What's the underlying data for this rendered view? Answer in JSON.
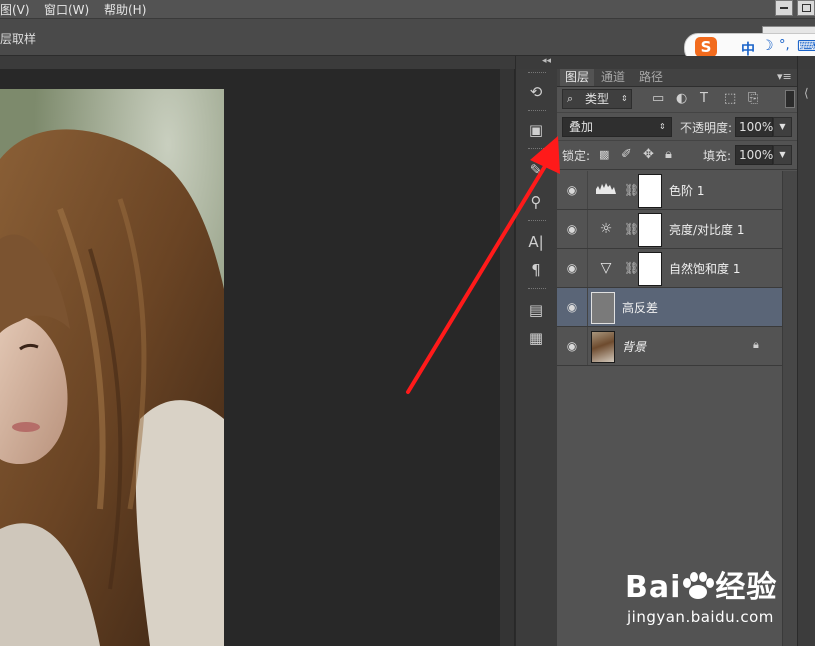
{
  "menu": {
    "items": [
      {
        "label": "图(V)"
      },
      {
        "label": "窗口(W)"
      },
      {
        "label": "帮助(H)"
      }
    ]
  },
  "options_bar": {
    "sample_label": "层取样"
  },
  "ime": {
    "logo": "S",
    "mode": "中",
    "moon": "☽",
    "punct": "°,",
    "keyboard": "⌨"
  },
  "layers_panel": {
    "tabs": [
      {
        "label": "图层",
        "active": true
      },
      {
        "label": "通道",
        "active": false
      },
      {
        "label": "路径",
        "active": false
      }
    ],
    "filter": {
      "icon": "search-icon",
      "label": "类型"
    },
    "blend_mode": "叠加",
    "opacity_label": "不透明度:",
    "opacity_value": "100%",
    "lock_label": "锁定:",
    "fill_label": "填充:",
    "fill_value": "100%",
    "layers": [
      {
        "name": "色阶 1",
        "icon": "levels-icon",
        "has_mask": true,
        "selected": false
      },
      {
        "name": "亮度/对比度 1",
        "icon": "brightness-icon",
        "has_mask": true,
        "selected": false
      },
      {
        "name": "自然饱和度 1",
        "icon": "vibrance-icon",
        "has_mask": true,
        "selected": false
      },
      {
        "name": "高反差",
        "icon": "gray-thumbnail",
        "has_mask": false,
        "selected": true
      },
      {
        "name": "背景",
        "icon": "photo-thumbnail",
        "has_mask": false,
        "selected": false,
        "locked": true
      }
    ]
  },
  "watermark": {
    "brand": "Bai",
    "brand_tail": "经验",
    "url": "jingyan.baidu.com"
  },
  "colors": {
    "accent_arrow": "#ff1a1a",
    "selected_layer": "#5a6577",
    "panel_bg": "#535353"
  }
}
